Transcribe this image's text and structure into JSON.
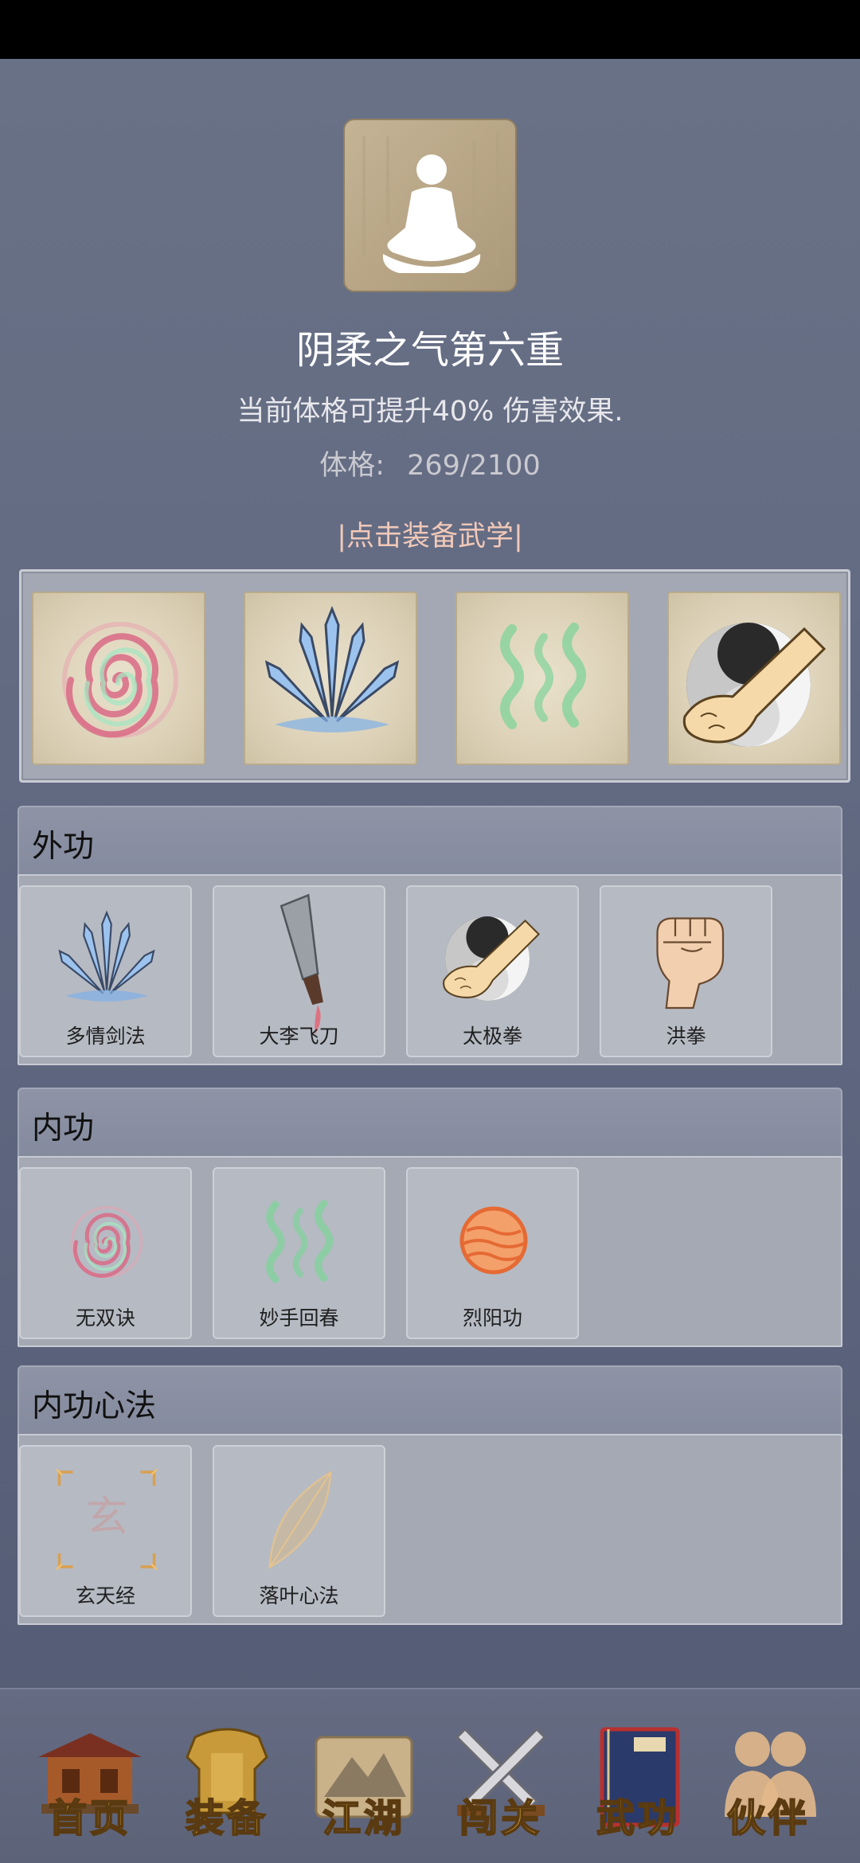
{
  "header": {
    "title": "阴柔之气第六重",
    "description": "当前体格可提升40% 伤害效果.",
    "stat_label": "体格:",
    "stat_value": "269/2100",
    "equip_link": "|点击装备武学|"
  },
  "equipped_slots": [
    {
      "icon": "spiral-qi-icon"
    },
    {
      "icon": "sword-fan-icon"
    },
    {
      "icon": "green-waves-icon"
    },
    {
      "icon": "taiji-fist-icon"
    }
  ],
  "sections": [
    {
      "title": "外功",
      "items": [
        {
          "label": "多情剑法",
          "icon": "sword-fan-icon"
        },
        {
          "label": "大李飞刀",
          "icon": "flying-knife-icon"
        },
        {
          "label": "太极拳",
          "icon": "taiji-fist-icon"
        },
        {
          "label": "洪拳",
          "icon": "fist-icon"
        }
      ]
    },
    {
      "title": "内功",
      "items": [
        {
          "label": "无双诀",
          "icon": "spiral-qi-icon"
        },
        {
          "label": "妙手回春",
          "icon": "green-waves-icon"
        },
        {
          "label": "烈阳功",
          "icon": "fire-orb-icon"
        }
      ]
    },
    {
      "title": "内功心法",
      "items": [
        {
          "label": "玄天经",
          "icon": "xuan-scroll-icon",
          "glyph": "玄"
        },
        {
          "label": "落叶心法",
          "icon": "leaf-icon"
        }
      ]
    }
  ],
  "bottom_nav": [
    {
      "label": "首页",
      "icon": "house-icon"
    },
    {
      "label": "装备",
      "icon": "armor-icon"
    },
    {
      "label": "江湖",
      "icon": "mountain-scroll-icon"
    },
    {
      "label": "闯关",
      "icon": "crossed-swords-icon"
    },
    {
      "label": "武功",
      "icon": "book-icon"
    },
    {
      "label": "伙伴",
      "icon": "companions-icon"
    }
  ],
  "colors": {
    "background": "#5f6780",
    "equip_link": "#f2c9b8",
    "nav_label": "#f1c64a"
  }
}
